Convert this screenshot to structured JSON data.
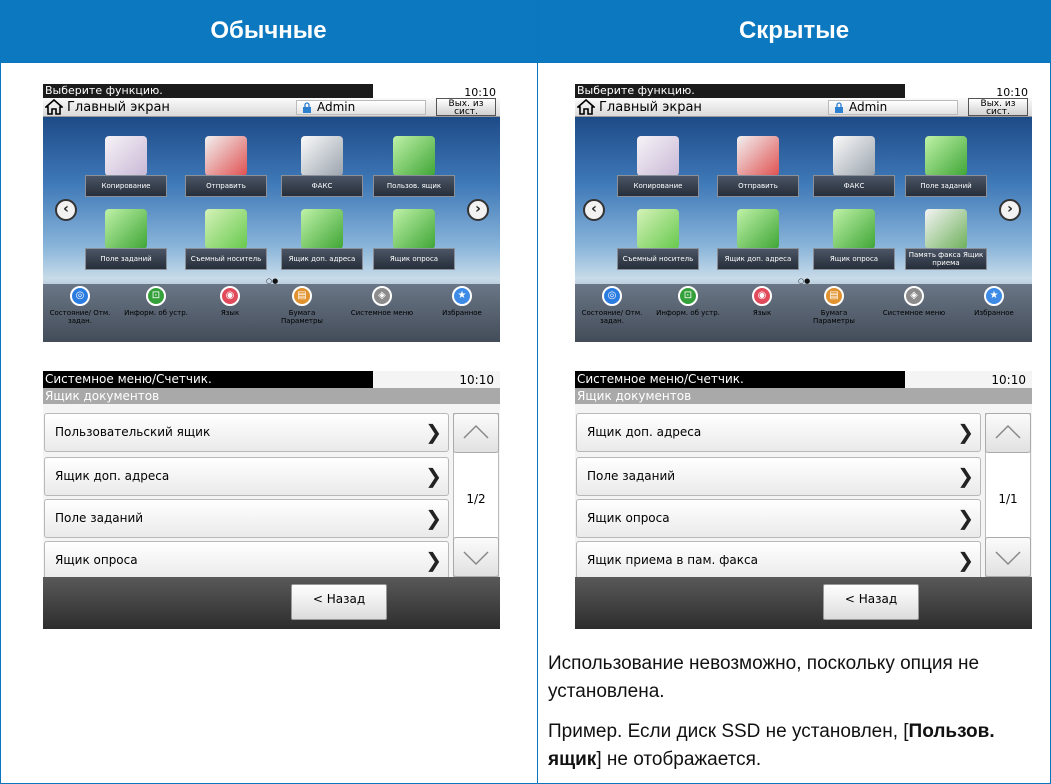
{
  "headers": {
    "left": "Обычные",
    "right": "Скрытые"
  },
  "home_left": {
    "message": "Выберите функцию.",
    "time": "10:10",
    "title": "Главный экран",
    "user": "Admin",
    "exit_label": "Вых. из сист.",
    "tiles": [
      "Копирование",
      "Отправить",
      "ФАКС",
      "Пользов. ящик",
      "Поле заданий",
      "Съемный носитель",
      "Ящик доп. адреса",
      "Ящик опроса"
    ],
    "page_indicator": "○●",
    "bottom": [
      "Состояние/ Отм. задан.",
      "Информ. об устр.",
      "Язык",
      "Бумага Параметры",
      "Системное меню",
      "Избранное"
    ]
  },
  "home_right": {
    "message": "Выберите функцию.",
    "time": "10:10",
    "title": "Главный экран",
    "user": "Admin",
    "exit_label": "Вых. из сист.",
    "tiles": [
      "Копирование",
      "Отправить",
      "ФАКС",
      "Поле заданий",
      "Съемный носитель",
      "Ящик доп. адреса",
      "Ящик опроса",
      "Память факса Ящик приема"
    ],
    "page_indicator": "○●",
    "bottom": [
      "Состояние/ Отм. задан.",
      "Информ. об устр.",
      "Язык",
      "Бумага Параметры",
      "Системное меню",
      "Избранное"
    ]
  },
  "sys_left": {
    "message": "Системное меню/Счетчик.",
    "time": "10:10",
    "subtitle": "Ящик документов",
    "rows": [
      "Пользовательский ящик",
      "Ящик доп. адреса",
      "Поле заданий",
      "Ящик опроса"
    ],
    "page": "1/2",
    "back": "< Назад"
  },
  "sys_right": {
    "message": "Системное меню/Счетчик.",
    "time": "10:10",
    "subtitle": "Ящик документов",
    "rows": [
      "Ящик доп. адреса",
      "Поле заданий",
      "Ящик опроса",
      "Ящик приема в пам. факса"
    ],
    "page": "1/1",
    "back": "< Назад"
  },
  "note": {
    "line1": "Использование невозможно, поскольку опция не установлена.",
    "line2_prefix": "Пример. Если диск SSD не установлен, [",
    "line2_bold": "Пользов. ящик",
    "line2_suffix": "] не отображается."
  },
  "colors": {
    "header_blue": "#0b78bf",
    "border_blue": "#0b76bd"
  }
}
